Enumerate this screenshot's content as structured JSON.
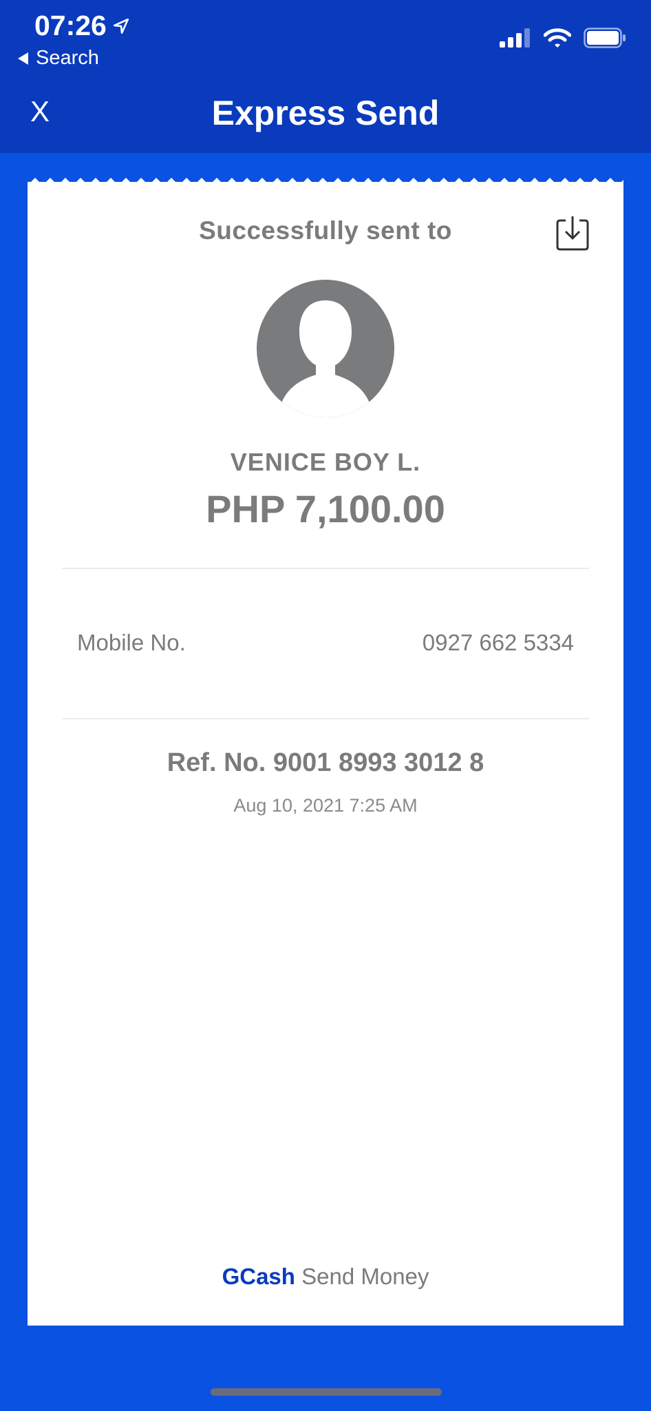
{
  "status_bar": {
    "time": "07:26",
    "back_label": "Search"
  },
  "header": {
    "close_label": "X",
    "title": "Express Send"
  },
  "receipt": {
    "heading": "Successfully sent to",
    "recipient_name": "VENICE BOY L.",
    "amount": "PHP 7,100.00",
    "mobile_label": "Mobile No.",
    "mobile_value": "0927 662 5334",
    "ref_no": "Ref. No. 9001 8993 3012 8",
    "datetime": "Aug 10, 2021 7:25 AM",
    "footer_brand": "GCash",
    "footer_text": "Send Money"
  },
  "colors": {
    "header_bg": "#0a3bbd",
    "page_bg": "#0a52e1",
    "text_gray": "#7b7b7b",
    "brand_blue": "#0a3bbd"
  },
  "icons": [
    "location-arrow-icon",
    "back-triangle-icon",
    "signal-icon",
    "wifi-icon",
    "battery-icon",
    "download-icon",
    "avatar-placeholder-icon"
  ]
}
